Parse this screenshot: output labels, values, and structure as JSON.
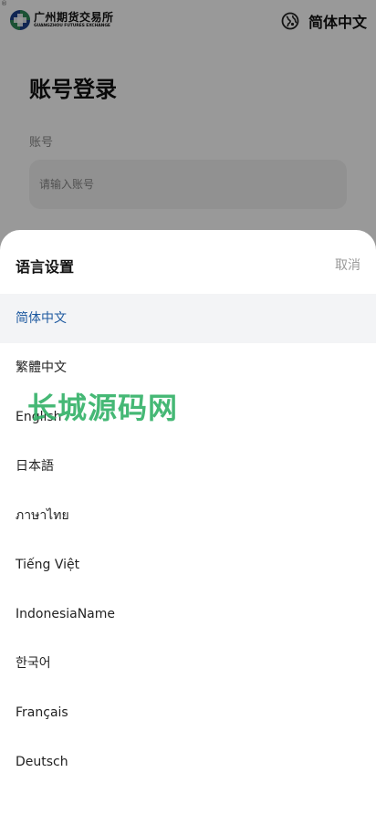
{
  "header": {
    "logo_cn": "广州期货交易所",
    "logo_en": "GUANGZHOU FUTURES EXCHANGE",
    "current_language": "简体中文",
    "corner_mark": "®"
  },
  "login": {
    "title": "账号登录",
    "account_label": "账号",
    "account_placeholder": "请输入账号"
  },
  "language_sheet": {
    "title": "语言设置",
    "cancel_label": "取消",
    "options": [
      {
        "label": "简体中文",
        "selected": true
      },
      {
        "label": "繁體中文",
        "selected": false
      },
      {
        "label": "English",
        "selected": false
      },
      {
        "label": "日本語",
        "selected": false
      },
      {
        "label": "ภาษาไทย",
        "selected": false
      },
      {
        "label": "Tiếng Việt",
        "selected": false
      },
      {
        "label": "IndonesiaName",
        "selected": false
      },
      {
        "label": "한국어",
        "selected": false
      },
      {
        "label": "Français",
        "selected": false
      },
      {
        "label": "Deutsch",
        "selected": false
      }
    ]
  },
  "watermark": "长城源码网",
  "colors": {
    "selected_text": "#1f5aa0",
    "selected_bg": "#f3f4f6",
    "watermark": "#36b36a",
    "logo_green": "#2e8b57",
    "logo_blue": "#1b3f8b"
  },
  "icons": {
    "logo": "gfex-logo-icon",
    "language": "globe-icon"
  }
}
